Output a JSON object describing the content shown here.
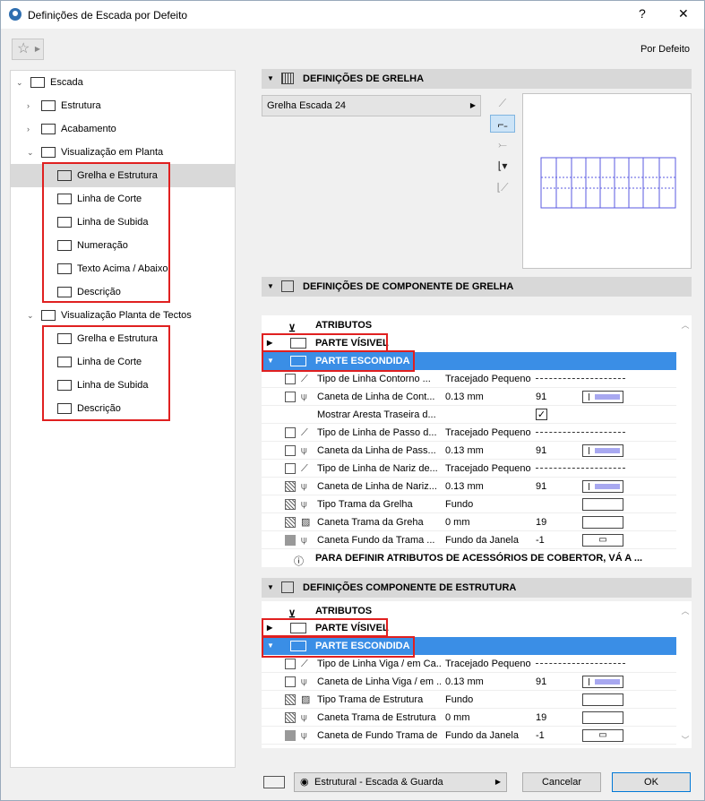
{
  "window": {
    "title": "Definições de Escada por Defeito",
    "help": "?",
    "close": "✕",
    "preset_label": "Por Defeito",
    "favorites_icon": "star-icon"
  },
  "tree": [
    {
      "label": "Escada",
      "level": 0,
      "twisty": "down",
      "icon": "stair-icon"
    },
    {
      "label": "Estrutura",
      "level": 1,
      "twisty": "right",
      "icon": "structure-icon"
    },
    {
      "label": "Acabamento",
      "level": 1,
      "twisty": "right",
      "icon": "finish-icon"
    },
    {
      "label": "Visualização em Planta",
      "level": 1,
      "twisty": "down",
      "icon": "floor-plan-icon"
    },
    {
      "label": "Grelha e Estrutura",
      "level": 2,
      "selected": true,
      "icon": "grid-icon"
    },
    {
      "label": "Linha de Corte",
      "level": 2,
      "icon": "break-line-icon"
    },
    {
      "label": "Linha de Subida",
      "level": 2,
      "icon": "walking-line-icon"
    },
    {
      "label": "Numeração",
      "level": 2,
      "icon": "numbering-icon"
    },
    {
      "label": "Texto Acima / Abaixo",
      "level": 2,
      "icon": "text-icon"
    },
    {
      "label": "Descrição",
      "level": 2,
      "icon": "description-icon"
    },
    {
      "label": "Visualização Planta de Tectos",
      "level": 1,
      "twisty": "down",
      "icon": "ceiling-plan-icon"
    },
    {
      "label": "Grelha e Estrutura",
      "level": 2,
      "icon": "grid-icon"
    },
    {
      "label": "Linha de Corte",
      "level": 2,
      "icon": "break-line-icon"
    },
    {
      "label": "Linha de Subida",
      "level": 2,
      "icon": "walking-line-icon"
    },
    {
      "label": "Descrição",
      "level": 2,
      "icon": "description-icon"
    }
  ],
  "grid_section": {
    "header": "DEFINIÇÕES DE GRELHA",
    "dropdown": "Grelha Escada 24"
  },
  "grid_component_section": {
    "header": "DEFINIÇÕES DE COMPONENTE DE GRELHA",
    "attributes_label": "ATRIBUTOS",
    "visible_part": "PARTE VÍSIVEL",
    "hidden_part": "PARTE ESCONDIDA",
    "rows": [
      {
        "name": "Tipo de Linha Contorno ...",
        "value": "Tracejado Pequeno",
        "pen": "",
        "kind": "line",
        "box": "empty"
      },
      {
        "name": "Caneta de Linha de Cont...",
        "value": "0.13 mm",
        "pen": "91",
        "kind": "pen",
        "box": "empty"
      },
      {
        "name": "Mostrar Aresta Traseira d...",
        "value": "",
        "pen": "",
        "kind": "check",
        "box": "none"
      },
      {
        "name": "Tipo de Linha de Passo d...",
        "value": "Tracejado Pequeno",
        "pen": "",
        "kind": "line",
        "box": "empty"
      },
      {
        "name": "Caneta da Linha de Pass...",
        "value": "0.13 mm",
        "pen": "91",
        "kind": "pen",
        "box": "empty"
      },
      {
        "name": "Tipo de Linha de Nariz de...",
        "value": "Tracejado Pequeno",
        "pen": "",
        "kind": "line",
        "box": "empty"
      },
      {
        "name": "Caneta de Linha de Nariz...",
        "value": "0.13 mm",
        "pen": "91",
        "kind": "pen",
        "box": "hatch"
      },
      {
        "name": "Tipo Trama da Grelha",
        "value": "Fundo",
        "pen": "",
        "kind": "fill",
        "box": "hatch"
      },
      {
        "name": "Caneta Trama da Greha",
        "value": "0 mm",
        "pen": "19",
        "kind": "fill",
        "box": "hatch"
      },
      {
        "name": "Caneta Fundo da Trama ...",
        "value": "Fundo da Janela",
        "pen": "-1",
        "kind": "monitor",
        "box": "gray"
      }
    ],
    "info": "PARA DEFINIR ATRIBUTOS DE ACESSÓRIOS DE COBERTOR, VÁ A ..."
  },
  "structure_component_section": {
    "header": "DEFINIÇÕES COMPONENTE DE ESTRUTURA",
    "attributes_label": "ATRIBUTOS",
    "visible_part": "PARTE VÍSIVEL",
    "hidden_part": "PARTE ESCONDIDA",
    "rows": [
      {
        "name": "Tipo de Linha Viga / em Ca...",
        "value": "Tracejado Pequeno",
        "pen": "",
        "kind": "line",
        "box": "empty"
      },
      {
        "name": "Caneta de Linha Viga / em ...",
        "value": "0.13 mm",
        "pen": "91",
        "kind": "pen",
        "box": "empty"
      },
      {
        "name": "Tipo Trama de Estrutura",
        "value": "Fundo",
        "pen": "",
        "kind": "fill",
        "box": "hatch"
      },
      {
        "name": "Caneta Trama de Estrutura",
        "value": "0 mm",
        "pen": "19",
        "kind": "fill",
        "box": "hatch"
      },
      {
        "name": "Caneta de Fundo Trama de ...",
        "value": "Fundo da Janela",
        "pen": "-1",
        "kind": "monitor",
        "box": "gray"
      }
    ]
  },
  "footer": {
    "layer": "Estrutural - Escada & Guarda",
    "cancel": "Cancelar",
    "ok": "OK"
  }
}
